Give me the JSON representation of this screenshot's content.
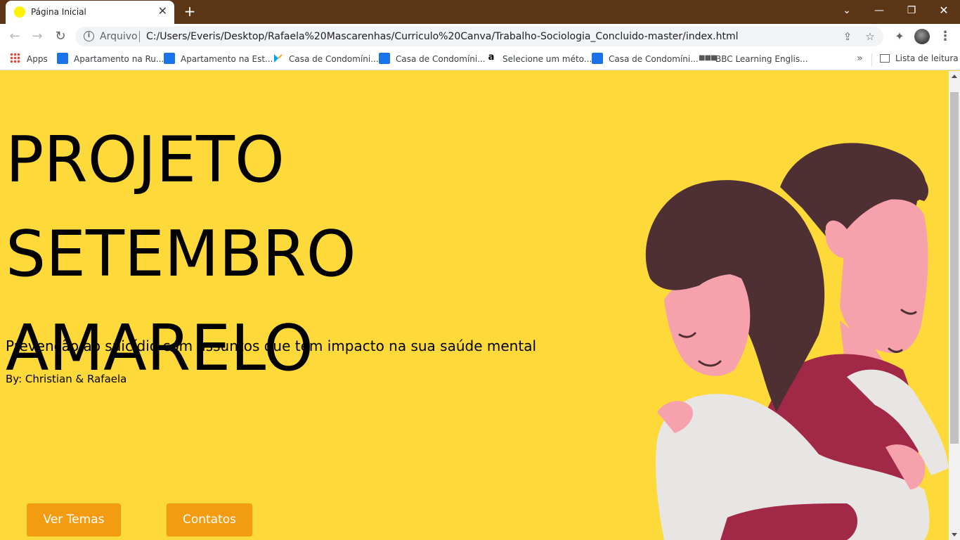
{
  "browser": {
    "tab": {
      "title": "Página Inicial",
      "favicon": "yellow-circle-icon",
      "favicon_color": "#fff200"
    },
    "new_tab_icon": "+",
    "window_controls": {
      "dropdown": "⌄",
      "minimize": "—",
      "restore": "❐",
      "close": "✕"
    },
    "omnibox": {
      "scheme_label": "Arquivo",
      "url": "C:/Users/Everis/Desktop/Rafaela%20Mascarenhas/Curriculo%20Canva/Trabalho-Sociologia_Concluido-master/index.html"
    },
    "bookmarks": [
      {
        "label": "Apps",
        "icon": "apps-grid-icon"
      },
      {
        "label": "Apartamento na Ru...",
        "icon": "house-icon"
      },
      {
        "label": "Apartamento na Est...",
        "icon": "house-icon"
      },
      {
        "label": "Casa de Condomíni...",
        "icon": "kite-icon"
      },
      {
        "label": "Casa de Condomíni...",
        "icon": "house-icon"
      },
      {
        "label": "Selecione um méto...",
        "icon": "amazon-icon"
      },
      {
        "label": "Casa de Condomíni...",
        "icon": "house-icon"
      },
      {
        "label": "BBC Learning Englis...",
        "icon": "bbc-icon"
      }
    ],
    "bookmarks_overflow": "»",
    "reading_list": "Lista de leitura"
  },
  "page": {
    "title": "PROJETO SETEMBRO AMARELO",
    "subtitle": "Prevenção ao suicídio com assuntos que tem impacto na sua saúde mental",
    "byline": "By: Christian & Rafaela",
    "buttons": {
      "temas": "Ver Temas",
      "contatos": "Contatos"
    },
    "colors": {
      "background": "#fed93a",
      "button": "#f39c12",
      "title_text": "#000000"
    },
    "illustration": "two-people-hugging-illustration"
  }
}
